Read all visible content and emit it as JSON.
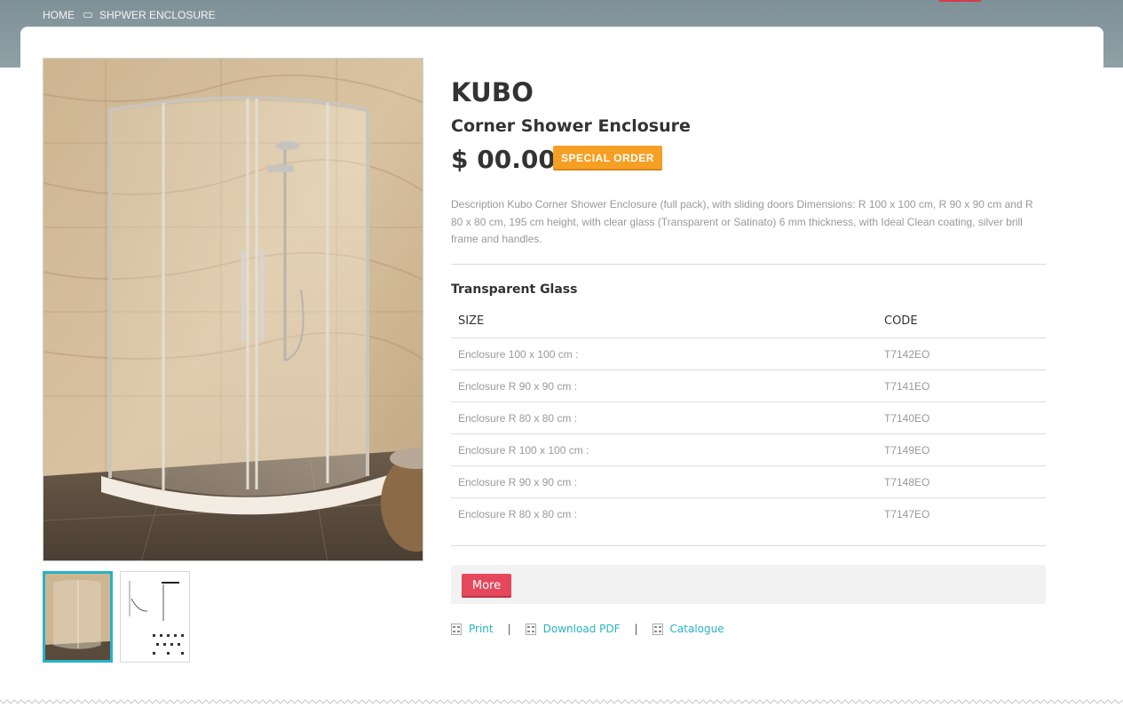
{
  "breadcrumb": {
    "home": "HOME",
    "current": "SHPWER ENCLOSURE"
  },
  "product": {
    "name": "KUBO",
    "subtitle": "Corner Shower Enclosure",
    "price": "$ 00.00",
    "badge": "SPECIAL ORDER",
    "description": "Description Kubo Corner Shower Enclosure (full pack), with sliding doors Dimensions: R 100 x 100 cm, R 90 x 90 cm and R 80 x 80 cm, 195 cm height, with clear glass (Transparent or Satinato) 6 mm thickness, with Ideal Clean coating, silver brill frame and handles."
  },
  "variants": {
    "heading": "Transparent Glass",
    "columns": [
      "SIZE",
      "CODE"
    ],
    "rows": [
      {
        "size": "Enclosure 100 x 100 cm :",
        "code": "T7142EO"
      },
      {
        "size": "Enclosure R 90 x 90 cm :",
        "code": "T7141EO"
      },
      {
        "size": "Enclosure R 80 x 80 cm :",
        "code": "T7140EO"
      },
      {
        "size": "Enclosure R 100 x 100 cm :",
        "code": "T7149EO"
      },
      {
        "size": "Enclosure R 90 x 90 cm :",
        "code": "T7148EO"
      },
      {
        "size": "Enclosure R 80 x 80 cm :",
        "code": "T7147EO"
      }
    ]
  },
  "actions": {
    "more": "More",
    "print": "Print",
    "download_pdf": "Download PDF",
    "catalogue": "Catalogue",
    "separator": "|"
  },
  "colors": {
    "accent": "#27b2c6",
    "badge": "#f5a024",
    "button": "#e5485c"
  }
}
